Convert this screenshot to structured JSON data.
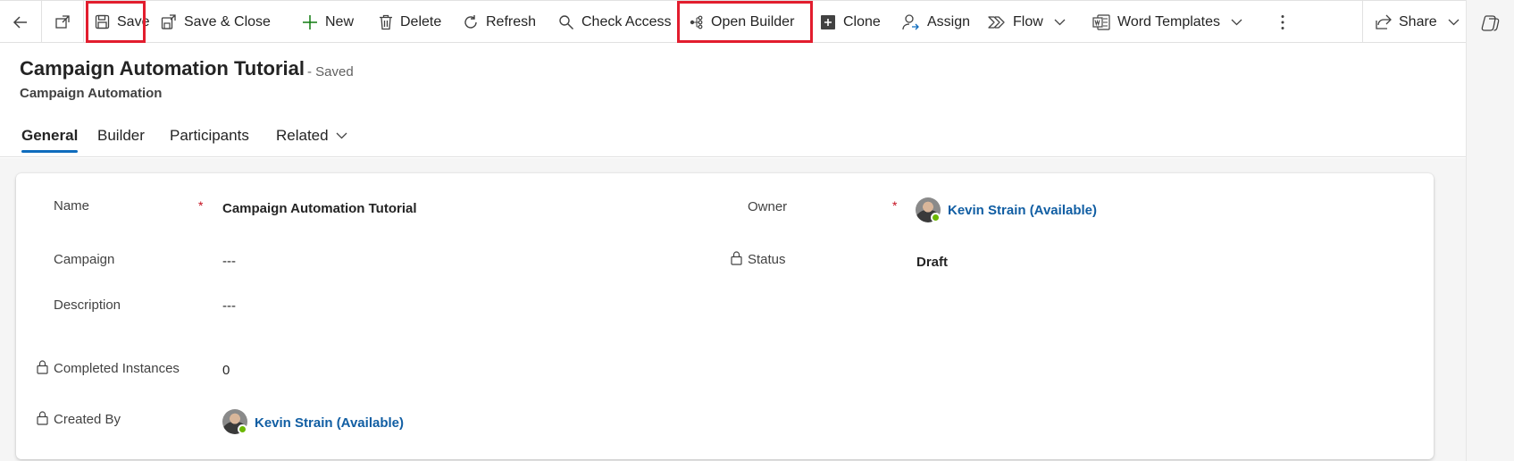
{
  "commandbar": {
    "save": "Save",
    "save_close": "Save & Close",
    "new": "New",
    "delete": "Delete",
    "refresh": "Refresh",
    "check_access": "Check Access",
    "open_builder": "Open Builder",
    "clone": "Clone",
    "assign": "Assign",
    "flow": "Flow",
    "word_templates": "Word Templates",
    "share": "Share"
  },
  "header": {
    "title": "Campaign Automation Tutorial",
    "saved_state": "- Saved",
    "entity": "Campaign Automation"
  },
  "tabs": [
    {
      "label": "General"
    },
    {
      "label": "Builder"
    },
    {
      "label": "Participants"
    },
    {
      "label": "Related"
    }
  ],
  "form": {
    "name_label": "Name",
    "name_value": "Campaign Automation Tutorial",
    "campaign_label": "Campaign",
    "campaign_value": "---",
    "description_label": "Description",
    "description_value": "---",
    "completed_label": "Completed Instances",
    "completed_value": "0",
    "created_by_label": "Created By",
    "created_by_value": "Kevin Strain (Available)",
    "owner_label": "Owner",
    "owner_value": "Kevin Strain (Available)",
    "status_label": "Status",
    "status_value": "Draft",
    "required_mark": "*"
  },
  "colors": {
    "accent": "#0f6cbd",
    "link": "#115ea3",
    "highlight": "#e21d2e",
    "required": "#c50f1f",
    "presence": "#6bb700"
  }
}
